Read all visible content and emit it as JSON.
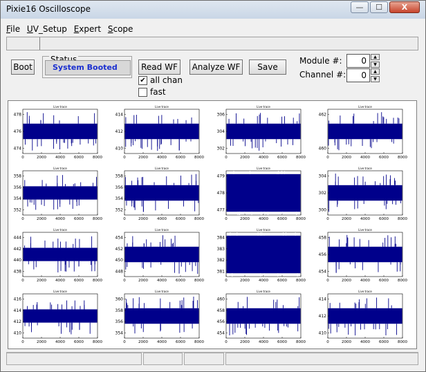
{
  "window": {
    "title": "Pixie16 Oscilloscope",
    "minimize": "—",
    "maximize": "☐",
    "close": "X"
  },
  "menu": [
    "File",
    "UV_Setup",
    "Expert",
    "Scope"
  ],
  "toolbar": {
    "boot": "Boot",
    "read_wf": "Read WF",
    "analyze_wf": "Analyze WF",
    "save": "Save"
  },
  "status": {
    "legend": "Status",
    "value": "System Booted"
  },
  "options": {
    "all_chan": {
      "label": "all chan",
      "checked": true
    },
    "fast": {
      "label": "fast",
      "checked": false
    }
  },
  "module": {
    "label": "Module #:",
    "value": "0"
  },
  "channel": {
    "label": "Channel #:",
    "value": "0"
  },
  "trace_color": "#00008b",
  "x_ticks": [
    "0",
    "2000",
    "4000",
    "6000",
    "8000"
  ],
  "plots": [
    {
      "title": "Live trace",
      "yticks": [
        "478",
        "476",
        "474"
      ],
      "fill": 0.35
    },
    {
      "title": "Live trace",
      "yticks": [
        "414",
        "412",
        "410"
      ],
      "fill": 0.35
    },
    {
      "title": "Live trace",
      "yticks": [
        "306",
        "304",
        "302"
      ],
      "fill": 0.35
    },
    {
      "title": "Live trace",
      "yticks": [
        "462",
        "460"
      ],
      "fill": 0.35
    },
    {
      "title": "Live trace",
      "yticks": [
        "358",
        "356",
        "354",
        "352"
      ],
      "fill": 0.3
    },
    {
      "title": "Live trace",
      "yticks": [
        "358",
        "356",
        "354",
        "352"
      ],
      "fill": 0.35
    },
    {
      "title": "Live trace",
      "yticks": [
        "479",
        "478",
        "477"
      ],
      "fill": 0.85
    },
    {
      "title": "Live trace",
      "yticks": [
        "304",
        "302",
        "300"
      ],
      "fill": 0.35
    },
    {
      "title": "Live trace",
      "yticks": [
        "444",
        "442",
        "440",
        "438"
      ],
      "fill": 0.3
    },
    {
      "title": "Live trace",
      "yticks": [
        "454",
        "452",
        "450",
        "448"
      ],
      "fill": 0.35
    },
    {
      "title": "Live trace",
      "yticks": [
        "384",
        "383",
        "382",
        "381"
      ],
      "fill": 0.85
    },
    {
      "title": "Live trace",
      "yticks": [
        "458",
        "456",
        "454"
      ],
      "fill": 0.35
    },
    {
      "title": "Live trace",
      "yticks": [
        "416",
        "414",
        "412",
        "410"
      ],
      "fill": 0.3
    },
    {
      "title": "Live trace",
      "yticks": [
        "360",
        "358",
        "356",
        "354"
      ],
      "fill": 0.35
    },
    {
      "title": "Live trace",
      "yticks": [
        "460",
        "458",
        "456",
        "454"
      ],
      "fill": 0.35
    },
    {
      "title": "Live trace",
      "yticks": [
        "414",
        "412",
        "410"
      ],
      "fill": 0.35
    }
  ]
}
